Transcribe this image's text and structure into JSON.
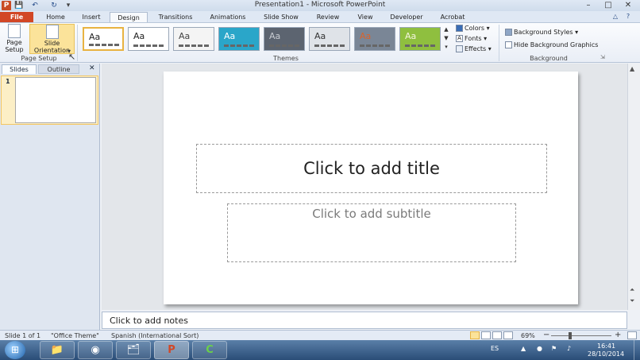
{
  "window": {
    "title": "Presentation1 - Microsoft PowerPoint",
    "app_icon": "P",
    "controls": {
      "minimize": "–",
      "maximize": "□",
      "close": "✕"
    }
  },
  "quick_access": {
    "save_icon": "save-icon",
    "undo_icon": "undo-icon",
    "redo_icon": "redo-icon",
    "customize_icon": "customize-icon"
  },
  "tabs": [
    "File",
    "Home",
    "Insert",
    "Design",
    "Transitions",
    "Animations",
    "Slide Show",
    "Review",
    "View",
    "Developer",
    "Acrobat"
  ],
  "active_tab": "Design",
  "ribbon": {
    "page_setup": {
      "page_setup_label": "Page\nSetup",
      "slide_orientation_label": "Slide\nOrientation",
      "dropdown_glyph": "▾",
      "group_label": "Page Setup"
    },
    "themes": {
      "items": [
        {
          "aa": "Aa",
          "bg": "#ffffff",
          "fg": "#222222"
        },
        {
          "aa": "Aa",
          "bg": "#ffffff",
          "fg": "#222222"
        },
        {
          "aa": "Aa",
          "bg": "#f4f4f4",
          "fg": "#444444"
        },
        {
          "aa": "Aa",
          "bg": "#2aa6c9",
          "fg": "#ffffff"
        },
        {
          "aa": "Aa",
          "bg": "#5c6470",
          "fg": "#c8ccd2"
        },
        {
          "aa": "Aa",
          "bg": "#dfe3e8",
          "fg": "#333333"
        },
        {
          "aa": "Aa",
          "bg": "#7a8696",
          "fg": "#d9632c"
        },
        {
          "aa": "Aa",
          "bg": "#8fbf3f",
          "fg": "#f5f5e0"
        }
      ],
      "group_label": "Themes",
      "colors_label": "Colors",
      "fonts_label": "Fonts",
      "effects_label": "Effects"
    },
    "background": {
      "background_styles_label": "Background Styles",
      "hide_background_graphics_label": "Hide Background Graphics",
      "group_label": "Background"
    }
  },
  "left_panel": {
    "slides_tab": "Slides",
    "outline_tab": "Outline",
    "close_glyph": "✕",
    "slide_number": "1"
  },
  "slide": {
    "title_placeholder": "Click to add title",
    "subtitle_placeholder": "Click to add subtitle"
  },
  "notes": {
    "placeholder": "Click to add notes"
  },
  "status_bar": {
    "slide_info": "Slide 1 of 1",
    "theme": "\"Office Theme\"",
    "language": "Spanish (International Sort)",
    "zoom": "69%",
    "zoom_out": "−",
    "zoom_in": "+"
  },
  "taskbar": {
    "start_glyph": "⊞",
    "apps": [
      {
        "name": "explorer",
        "glyph": "📁"
      },
      {
        "name": "chrome",
        "glyph": "◉"
      },
      {
        "name": "folder",
        "glyph": "🗂"
      },
      {
        "name": "powerpoint",
        "glyph": "P"
      },
      {
        "name": "camtasia",
        "glyph": "C"
      }
    ],
    "language": "ES",
    "time": "16:41",
    "date": "28/10/2014"
  },
  "colors": {
    "file_tab": "#d24726",
    "selected_highlight": "#fbe39a",
    "taskbar": "#2a4d77"
  }
}
